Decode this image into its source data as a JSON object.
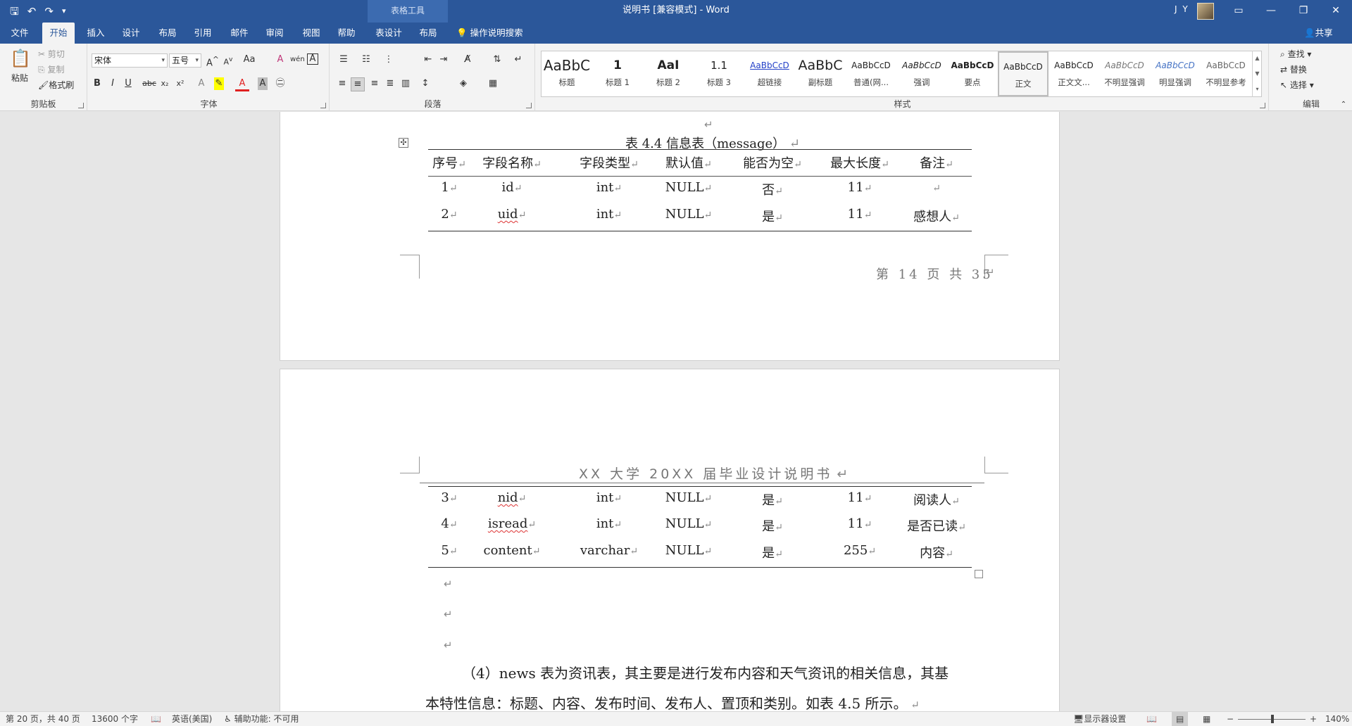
{
  "titlebar": {
    "title": "说明书 [兼容模式] - Word",
    "context_tools": "表格工具",
    "user": "J Y",
    "qat_save": "🖫",
    "qat_undo": "↶",
    "qat_redo": "↷",
    "qat_more": "▾",
    "ctrl_ribbon": "▭",
    "ctrl_min": "—",
    "ctrl_restore": "❐",
    "ctrl_close": "✕"
  },
  "tabs": [
    "文件",
    "开始",
    "插入",
    "设计",
    "布局",
    "引用",
    "邮件",
    "审阅",
    "视图",
    "帮助",
    "表设计",
    "布局"
  ],
  "tellme": "操作说明搜索",
  "share": "共享",
  "clipboard": {
    "paste": "粘贴",
    "cut": "剪切",
    "copy": "复制",
    "format_painter": "格式刷",
    "label": "剪贴板"
  },
  "font": {
    "family": "宋体",
    "size": "五号",
    "label": "字体"
  },
  "paragraph": {
    "label": "段落"
  },
  "styles": {
    "label": "样式",
    "items": [
      {
        "sample": "AaBbC",
        "name": "标题"
      },
      {
        "sample": "1",
        "name": "标题 1"
      },
      {
        "sample": "AaI",
        "name": "标题 2"
      },
      {
        "sample": "1.1",
        "name": "标题 3"
      },
      {
        "sample": "AaBbCcD",
        "name": "超链接"
      },
      {
        "sample": "AaBbC",
        "name": "副标题"
      },
      {
        "sample": "AaBbCcD",
        "name": "普通(网..."
      },
      {
        "sample": "AaBbCcD",
        "name": "强调"
      },
      {
        "sample": "AaBbCcD",
        "name": "要点"
      },
      {
        "sample": "AaBbCcD",
        "name": "正文"
      },
      {
        "sample": "AaBbCcD",
        "name": "正文文..."
      },
      {
        "sample": "AaBbCcD",
        "name": "不明显强调"
      },
      {
        "sample": "AaBbCcD",
        "name": "明显强调"
      },
      {
        "sample": "AaBbCcD",
        "name": "不明显参考"
      }
    ]
  },
  "editing": {
    "find": "查找",
    "replace": "替换",
    "select": "选择",
    "label": "编辑"
  },
  "page1": {
    "caption": "表 4.4  信息表（message）",
    "headers": [
      "序号",
      "字段名称",
      "字段类型",
      "默认值",
      "能否为空",
      "最大长度",
      "备注"
    ],
    "rows": [
      [
        "1",
        "id",
        "int",
        "NULL",
        "否",
        "11",
        ""
      ],
      [
        "2",
        "uid",
        "int",
        "NULL",
        "是",
        "11",
        "感想人"
      ]
    ],
    "footer": "第 14 页 共 35"
  },
  "page2": {
    "header": "XX 大学 20XX 届毕业设计说明书",
    "rows": [
      [
        "3",
        "nid",
        "int",
        "NULL",
        "是",
        "11",
        "阅读人"
      ],
      [
        "4",
        "isread",
        "int",
        "NULL",
        "是",
        "11",
        "是否已读"
      ],
      [
        "5",
        "content",
        "varchar",
        "NULL",
        "是",
        "255",
        "内容"
      ]
    ],
    "body_line1": "（4）news 表为资讯表，其主要是进行发布内容和天气资讯的相关信息，其基",
    "body_line2": "本特性信息：标题、内容、发布时间、发布人、置顶和类别。如表 4.5 所示。"
  },
  "status": {
    "page": "第 20 页，共 40 页",
    "words": "13600 个字",
    "language": "英语(美国)",
    "accessibility": "辅助功能: 不可用",
    "display": "显示器设置",
    "zoom": "140%"
  }
}
